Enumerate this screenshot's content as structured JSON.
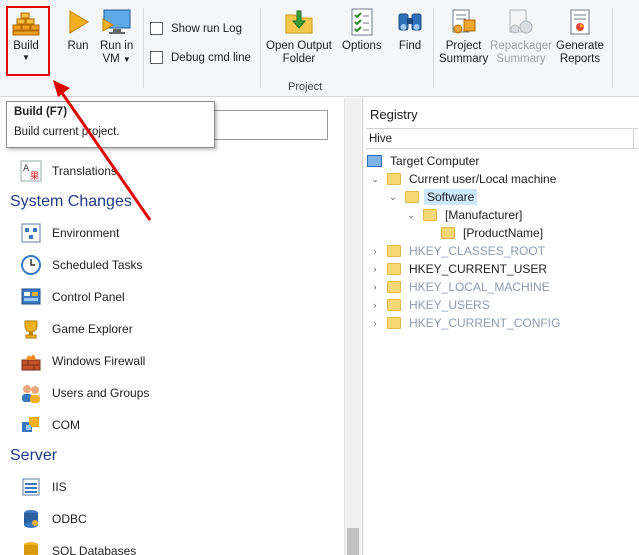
{
  "ribbon": {
    "build": {
      "label": "Build",
      "icon": "build-icon"
    },
    "run": {
      "label": "Run",
      "icon": "run-icon"
    },
    "run_in_vm": {
      "label_line1": "Run in",
      "label_line2": "VM",
      "icon": "vm-monitor-icon"
    },
    "show_run_log": "Show run Log",
    "debug_cmd_line": "Debug cmd line",
    "open_output_folder": {
      "label_line1": "Open Output",
      "label_line2": "Folder",
      "icon": "folder-arrow-icon"
    },
    "options": {
      "label": "Options",
      "icon": "options-checklist-icon"
    },
    "find": {
      "label": "Find",
      "icon": "binoculars-icon"
    },
    "project_summary": {
      "label_line1": "Project",
      "label_line2": "Summary",
      "icon": "project-summary-icon"
    },
    "repackager_summary": {
      "label_line1": "Repackager",
      "label_line2": "Summary",
      "icon": "repackager-summary-icon",
      "disabled": true
    },
    "generate_reports": {
      "label_line1": "Generate",
      "label_line2": "Reports",
      "icon": "reports-icon"
    },
    "group_label": "Project"
  },
  "tooltip": {
    "title": "Build (F7)",
    "text": "Build current project."
  },
  "left_nav": {
    "translations": "Translations",
    "system_changes": "System Changes",
    "environment": "Environment",
    "scheduled_tasks": "Scheduled Tasks",
    "control_panel": "Control Panel",
    "game_explorer": "Game Explorer",
    "windows_firewall": "Windows Firewall",
    "users_and_groups": "Users and Groups",
    "com": "COM",
    "server": "Server",
    "iis": "IIS",
    "odbc": "ODBC",
    "sql_databases": "SQL Databases"
  },
  "registry": {
    "title": "Registry",
    "column_header": "Hive",
    "tree": {
      "target_computer": "Target Computer",
      "current_user_local_machine": "Current user/Local machine",
      "software": "Software",
      "manufacturer": "[Manufacturer]",
      "product_name": "[ProductName]",
      "hkcr": "HKEY_CLASSES_ROOT",
      "hkcu": "HKEY_CURRENT_USER",
      "hklm": "HKEY_LOCAL_MACHINE",
      "hku": "HKEY_USERS",
      "hkcc": "HKEY_CURRENT_CONFIG"
    }
  },
  "colors": {
    "annotation_red": "#e00000",
    "section_blue": "#1f3c88",
    "selection": "#cce8ff",
    "disabled_hive": "#8c9ab0"
  }
}
